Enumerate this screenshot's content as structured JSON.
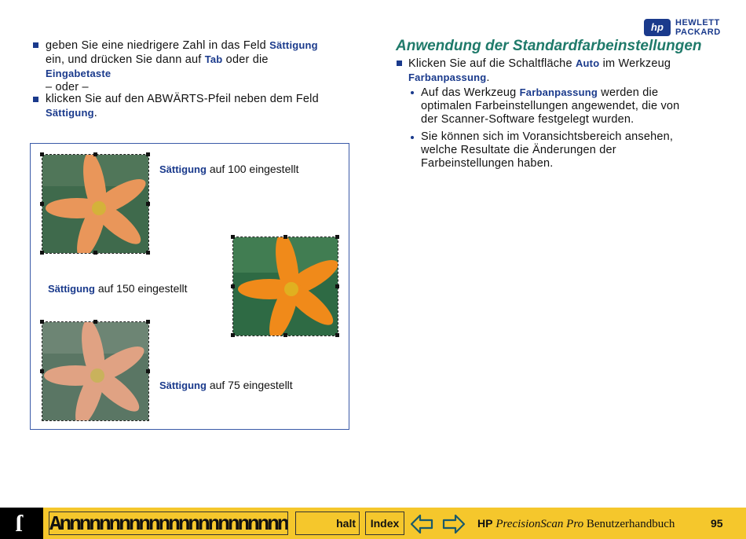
{
  "logo": {
    "badge": "hp",
    "line1": "HEWLETT",
    "line2": "PACKARD"
  },
  "left": {
    "bullet1": {
      "pre": "geben Sie eine niedrigere Zahl in das Feld ",
      "kw1": "Sättigung",
      "mid": "ein, und drücken Sie dann auf ",
      "kw2": "Tab",
      "post": " oder die",
      "kw3": "Eingabetaste",
      "oder": "– oder –"
    },
    "bullet2": {
      "pre": "klicken Sie auf den ABWÄRTS-Pfeil neben dem Feld",
      "kw": "Sättigung",
      "post": "."
    }
  },
  "figure": {
    "cap100": {
      "kw": "Sättigung",
      "text": " auf 100 eingestellt"
    },
    "cap150": {
      "kw": "Sättigung",
      "text": " auf 150 eingestellt"
    },
    "cap75": {
      "kw": "Sättigung",
      "text": " auf 75 eingestellt"
    }
  },
  "right": {
    "heading": "Anwendung der Standardfarbeinstellungen",
    "bullet": {
      "pre": "Klicken Sie auf die Schaltfläche ",
      "kw1": "Auto",
      "mid": " im Werkzeug",
      "kw2": "Farbanpassung",
      "post": "."
    },
    "sub1": {
      "pre": "Auf das Werkzeug ",
      "kw": "Farbanpassung",
      "post1": " werden die",
      "line2": "optimalen Farbeinstellungen angewendet, die von",
      "line3": "der Scanner-Software festgelegt wurden."
    },
    "sub2": {
      "line1": "Sie können sich im Voransichtsbereich ansehen,",
      "line2": "welche Resultate die Änderungen der",
      "line3": "Farbeinstellungen haben."
    }
  },
  "footer": {
    "left_glyph": "ſ",
    "chapter_garbled": "Annnnnnnnnnnnnnnnnnnnnnnnnn",
    "contents_label": "halt",
    "index_label": "Index",
    "title_bold": "HP",
    "title_italic": "PrecisionScan Pro",
    "title_rest": " Benutzerhandbuch",
    "page": "95"
  },
  "colors": {
    "accent": "#1a3a8c",
    "heading": "#1f7a6a",
    "footer": "#f5c72c"
  }
}
